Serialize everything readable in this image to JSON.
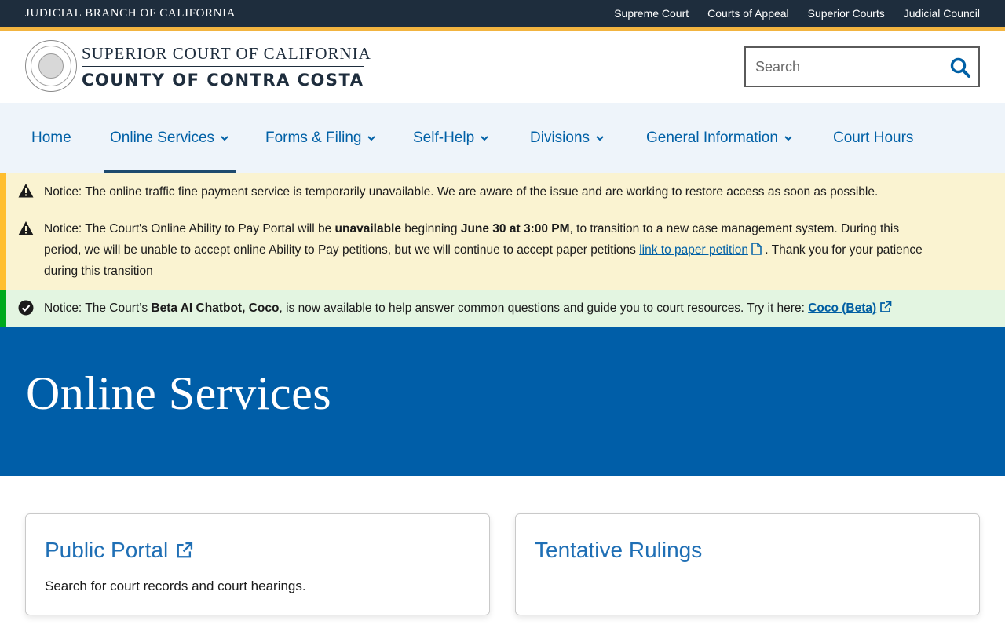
{
  "utility_bar": {
    "brand": "JUDICIAL BRANCH OF CALIFORNIA",
    "links": [
      "Supreme Court",
      "Courts of Appeal",
      "Superior Courts",
      "Judicial Council"
    ]
  },
  "header": {
    "court_line1": "SUPERIOR COURT OF CALIFORNIA",
    "court_line2": "COUNTY OF CONTRA COSTA",
    "search_placeholder": "Search"
  },
  "nav": {
    "home": "Home",
    "online_services": "Online Services",
    "forms_filing": "Forms & Filing",
    "self_help": "Self-Help",
    "divisions": "Divisions",
    "general_information": "General Information",
    "court_hours": "Court Hours"
  },
  "notices": {
    "n1": {
      "text": "Notice: The online traffic fine payment service is temporarily unavailable. We are aware of the issue and are working to restore access as soon as possible."
    },
    "n2": {
      "p1": "Notice: The Court's Online Ability to Pay Portal will be ",
      "b1": "unavailable",
      "p2": " beginning ",
      "b2": "June 30 at 3:00 PM",
      "p3": ", to transition to a new case management system. During this period, we will be unable to accept online Ability to Pay petitions, but we will continue to accept paper petitions ",
      "link": "link to paper petition",
      "p4": " . Thank you for your patience during this transition"
    },
    "n3": {
      "p1": "Notice: The Court’s ",
      "b1": "Beta AI Chatbot, Coco",
      "p2": ", is now available to help answer common questions and guide you to court resources. Try it here: ",
      "link": "Coco (Beta)"
    }
  },
  "hero": {
    "title": "Online Services"
  },
  "cards": [
    {
      "title": "Public Portal",
      "desc": "Search for court records and court hearings."
    },
    {
      "title": "Tentative Rulings",
      "desc": ""
    }
  ],
  "colors": {
    "utility_bg": "#1e2d3d",
    "gold_rule": "#f2b440",
    "nav_bg": "#eef4fa",
    "link": "#0060a6",
    "hero_bg": "#005ea8",
    "warn_bg": "#faf3d1",
    "ok_bg": "#e3f5e1"
  }
}
